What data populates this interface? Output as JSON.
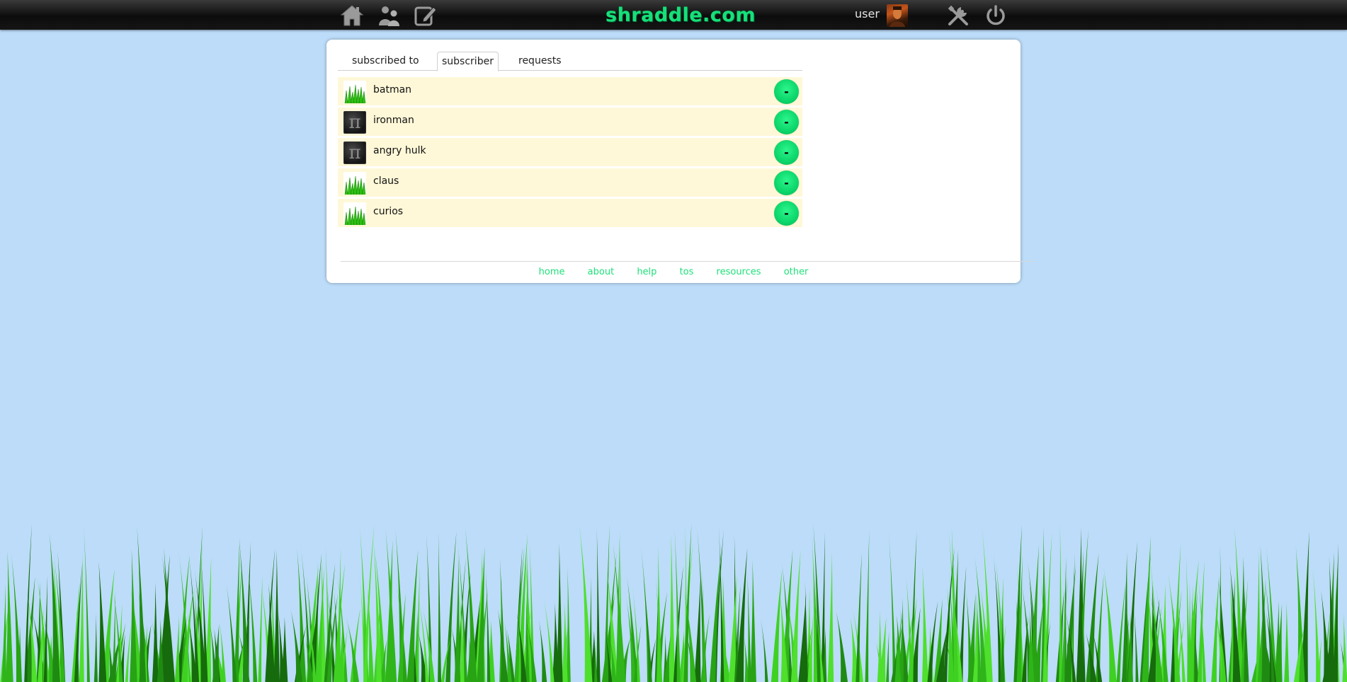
{
  "header": {
    "brand": "shraddle.com",
    "user_label": "user",
    "icons": [
      "home-icon",
      "users-icon",
      "edit-icon",
      "tools-icon",
      "power-icon"
    ]
  },
  "tabs": [
    {
      "label": "subscribed to",
      "active": false
    },
    {
      "label": "subscriber",
      "active": true
    },
    {
      "label": "requests",
      "active": false
    }
  ],
  "subscribers": [
    {
      "name": "batman",
      "avatar": "grass",
      "action": "-"
    },
    {
      "name": "ironman",
      "avatar": "pi",
      "action": "-"
    },
    {
      "name": "angry hulk",
      "avatar": "pi",
      "action": "-"
    },
    {
      "name": "claus",
      "avatar": "grass",
      "action": "-"
    },
    {
      "name": "curios",
      "avatar": "grass",
      "action": "-"
    }
  ],
  "pi_glyph": "π",
  "footer": {
    "links": [
      "home",
      "about",
      "help",
      "tos",
      "resources",
      "other"
    ]
  },
  "colors": {
    "background": "#bcdcf9",
    "accent": "#16e07a",
    "row": "#fff8d8",
    "topbar": "#0c0c0c"
  }
}
